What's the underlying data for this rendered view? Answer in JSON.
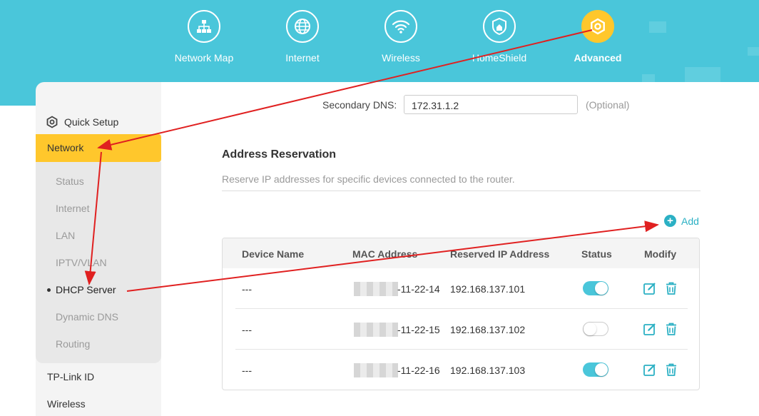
{
  "nav": {
    "items": [
      {
        "label": "Network Map",
        "icon": "network-map-icon"
      },
      {
        "label": "Internet",
        "icon": "globe-icon"
      },
      {
        "label": "Wireless",
        "icon": "wifi-icon"
      },
      {
        "label": "HomeShield",
        "icon": "homeshield-icon"
      },
      {
        "label": "Advanced",
        "icon": "advanced-gear-icon",
        "active": true
      }
    ]
  },
  "sidebar": {
    "quick_setup": "Quick Setup",
    "network": "Network",
    "sub_items": [
      "Status",
      "Internet",
      "LAN",
      "IPTV/VLAN",
      "DHCP Server",
      "Dynamic DNS",
      "Routing"
    ],
    "active_sub": "DHCP Server",
    "bottom_items": [
      "TP-Link ID",
      "Wireless"
    ]
  },
  "dns": {
    "label": "Secondary DNS:",
    "value": "172.31.1.2",
    "optional": "(Optional)"
  },
  "reservation": {
    "title": "Address Reservation",
    "description": "Reserve IP addresses for specific devices connected to the router.",
    "add_label": "Add",
    "columns": [
      "Device Name",
      "MAC Address",
      "Reserved IP Address",
      "Status",
      "Modify"
    ],
    "rows": [
      {
        "device": "---",
        "mac_suffix": "-11-22-14",
        "ip": "192.168.137.101",
        "enabled": true
      },
      {
        "device": "---",
        "mac_suffix": "-11-22-15",
        "ip": "192.168.137.102",
        "enabled": false
      },
      {
        "device": "---",
        "mac_suffix": "-11-22-16",
        "ip": "192.168.137.103",
        "enabled": true
      }
    ]
  },
  "colors": {
    "header": "#4ac6da",
    "accent": "#ffc72c",
    "link": "#2bb0c4",
    "arrow": "#e02020"
  }
}
